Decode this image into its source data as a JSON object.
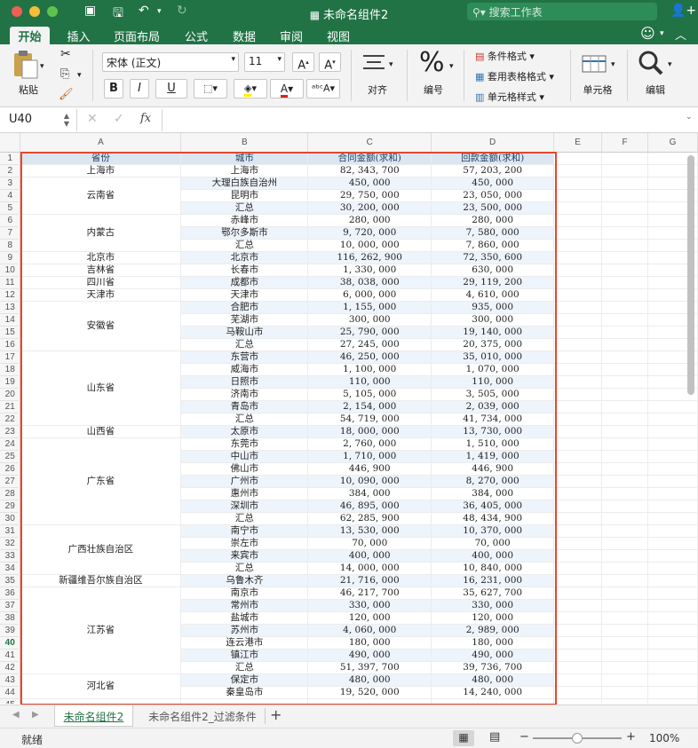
{
  "titlebar": {
    "title": "未命名组件2",
    "search_placeholder": "搜索工作表"
  },
  "tabs": [
    "开始",
    "插入",
    "页面布局",
    "公式",
    "数据",
    "审阅",
    "视图"
  ],
  "ribbon": {
    "paste_label": "粘贴",
    "font_name": "宋体 (正文)",
    "font_size": "11",
    "bold": "B",
    "italic": "I",
    "underline": "U",
    "align_label": "对齐",
    "number_label": "编号",
    "cond_format": "条件格式",
    "table_format": "套用表格格式",
    "cell_style": "单元格样式",
    "cells_label": "单元格",
    "edit_label": "编辑"
  },
  "formula_bar": {
    "name_box": "U40",
    "fx": "fx",
    "value": ""
  },
  "columns": [
    "A",
    "B",
    "C",
    "D",
    "E",
    "F",
    "G"
  ],
  "headers": [
    "省份",
    "城市",
    "合同金额(求和)",
    "回款金额(求和)"
  ],
  "rows": [
    [
      "上海市",
      "上海市",
      "82, 343, 700",
      "57, 203, 200"
    ],
    [
      "",
      "大理白族自治州",
      "450, 000",
      "450, 000"
    ],
    [
      "云南省",
      "昆明市",
      "29, 750, 000",
      "23, 050, 000"
    ],
    [
      "",
      "汇总",
      "30, 200, 000",
      "23, 500, 000"
    ],
    [
      "",
      "赤峰市",
      "280, 000",
      "280, 000"
    ],
    [
      "内蒙古",
      "鄂尔多斯市",
      "9, 720, 000",
      "7, 580, 000"
    ],
    [
      "",
      "汇总",
      "10, 000, 000",
      "7, 860, 000"
    ],
    [
      "北京市",
      "北京市",
      "116, 262, 900",
      "72, 350, 600"
    ],
    [
      "吉林省",
      "长春市",
      "1, 330, 000",
      "630, 000"
    ],
    [
      "四川省",
      "成都市",
      "38, 038, 000",
      "29, 119, 200"
    ],
    [
      "天津市",
      "天津市",
      "6, 000, 000",
      "4, 610, 000"
    ],
    [
      "",
      "合肥市",
      "1, 155, 000",
      "935, 000"
    ],
    [
      "安徽省",
      "芜湖市",
      "300, 000",
      "300, 000"
    ],
    [
      "",
      "马鞍山市",
      "25, 790, 000",
      "19, 140, 000"
    ],
    [
      "",
      "汇总",
      "27, 245, 000",
      "20, 375, 000"
    ],
    [
      "",
      "东营市",
      "46, 250, 000",
      "35, 010, 000"
    ],
    [
      "",
      "威海市",
      "1, 100, 000",
      "1, 070, 000"
    ],
    [
      "山东省",
      "日照市",
      "110, 000",
      "110, 000"
    ],
    [
      "",
      "济南市",
      "5, 105, 000",
      "3, 505, 000"
    ],
    [
      "",
      "青岛市",
      "2, 154, 000",
      "2, 039, 000"
    ],
    [
      "",
      "汇总",
      "54, 719, 000",
      "41, 734, 000"
    ],
    [
      "山西省",
      "太原市",
      "18, 000, 000",
      "13, 730, 000"
    ],
    [
      "",
      "东莞市",
      "2, 760, 000",
      "1, 510, 000"
    ],
    [
      "",
      "中山市",
      "1, 710, 000",
      "1, 419, 000"
    ],
    [
      "",
      "佛山市",
      "446, 900",
      "446, 900"
    ],
    [
      "广东省",
      "广州市",
      "10, 090, 000",
      "8, 270, 000"
    ],
    [
      "",
      "惠州市",
      "384, 000",
      "384, 000"
    ],
    [
      "",
      "深圳市",
      "46, 895, 000",
      "36, 405, 000"
    ],
    [
      "",
      "汇总",
      "62, 285, 900",
      "48, 434, 900"
    ],
    [
      "",
      "南宁市",
      "13, 530, 000",
      "10, 370, 000"
    ],
    [
      "广西壮族自治区",
      "崇左市",
      "70, 000",
      "70, 000"
    ],
    [
      "",
      "来宾市",
      "400, 000",
      "400, 000"
    ],
    [
      "",
      "汇总",
      "14, 000, 000",
      "10, 840, 000"
    ],
    [
      "新疆维吾尔族自治区",
      "乌鲁木齐",
      "21, 716, 000",
      "16, 231, 000"
    ],
    [
      "",
      "南京市",
      "46, 217, 700",
      "35, 627, 700"
    ],
    [
      "",
      "常州市",
      "330, 000",
      "330, 000"
    ],
    [
      "",
      "盐城市",
      "120, 000",
      "120, 000"
    ],
    [
      "江苏省",
      "苏州市",
      "4, 060, 000",
      "2, 989, 000"
    ],
    [
      "",
      "连云港市",
      "180, 000",
      "180, 000"
    ],
    [
      "",
      "镇江市",
      "490, 000",
      "490, 000"
    ],
    [
      "",
      "汇总",
      "51, 397, 700",
      "39, 736, 700"
    ],
    [
      "",
      "保定市",
      "480, 000",
      "480, 000"
    ],
    [
      "河北省",
      "秦皇岛市",
      "19, 520, 000",
      "14, 240, 000"
    ]
  ],
  "sheets": [
    "未命名组件2",
    "未命名组件2_过滤条件"
  ],
  "add_sheet": "+",
  "status": {
    "ready": "就绪",
    "zoom": "100%"
  },
  "colors": {
    "excel_green": "#217346",
    "header_fill": "#dce6f1",
    "band_fill": "#eef4fb",
    "outline": "#e8472b"
  }
}
